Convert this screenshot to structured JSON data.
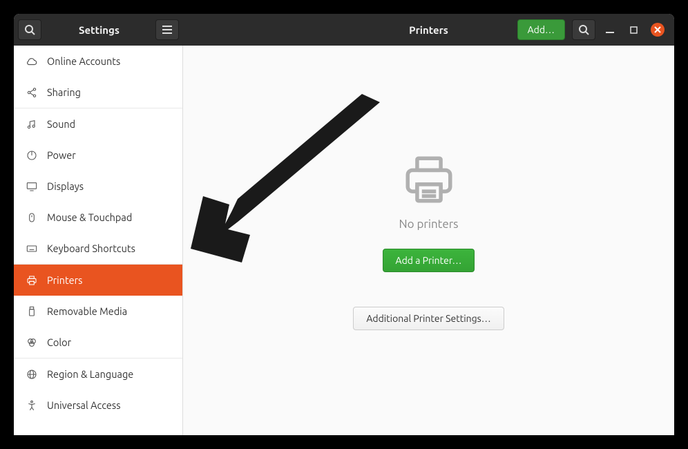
{
  "header": {
    "left_title": "Settings",
    "right_title": "Printers",
    "add_label": "Add…"
  },
  "sidebar": {
    "items": [
      {
        "icon": "cloud",
        "label": "Online Accounts",
        "active": false
      },
      {
        "icon": "share",
        "label": "Sharing",
        "active": false
      },
      {
        "icon": "sound",
        "label": "Sound",
        "active": false
      },
      {
        "icon": "power",
        "label": "Power",
        "active": false
      },
      {
        "icon": "displays",
        "label": "Displays",
        "active": false
      },
      {
        "icon": "mouse",
        "label": "Mouse & Touchpad",
        "active": false
      },
      {
        "icon": "keyboard",
        "label": "Keyboard Shortcuts",
        "active": false
      },
      {
        "icon": "printer",
        "label": "Printers",
        "active": true
      },
      {
        "icon": "usb",
        "label": "Removable Media",
        "active": false
      },
      {
        "icon": "color",
        "label": "Color",
        "active": false
      },
      {
        "icon": "globe",
        "label": "Region & Language",
        "active": false
      },
      {
        "icon": "access",
        "label": "Universal Access",
        "active": false
      }
    ],
    "separator_after": [
      1,
      6,
      9
    ]
  },
  "pane": {
    "message": "No printers",
    "primary_button": "Add a Printer…",
    "secondary_button": "Additional Printer Settings…"
  },
  "colors": {
    "accent": "#e95420",
    "green": "#3a9a3a"
  }
}
